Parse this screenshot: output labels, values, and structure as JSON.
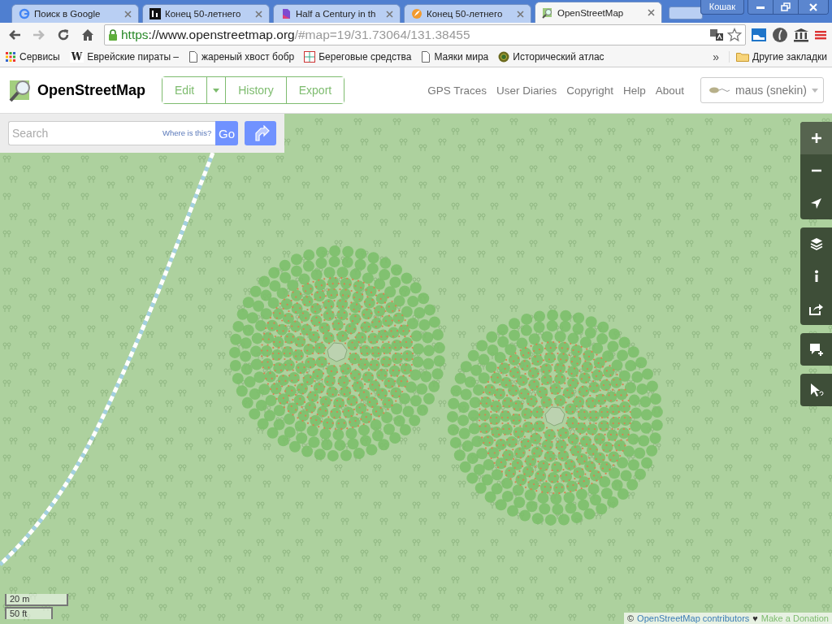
{
  "browser": {
    "tabs": [
      {
        "title": "Поиск в Google",
        "selected": false
      },
      {
        "title": "Конец 50-летнего",
        "selected": false
      },
      {
        "title": "Half a Century in th",
        "selected": false
      },
      {
        "title": "Конец 50-летнего",
        "selected": false
      },
      {
        "title": "OpenStreetMap",
        "selected": true
      }
    ],
    "profile": "Кошак",
    "address": {
      "scheme": "https",
      "host": "://www.openstreetmap.org",
      "path": "/#map=19/31.73064/131.38455"
    },
    "bookmarks": [
      {
        "label": "Сервисы"
      },
      {
        "label": "Еврейские пираты –",
        "letter": "W"
      },
      {
        "label": "жареный хвост бобр"
      },
      {
        "label": "Береговые средства"
      },
      {
        "label": "Маяки мира"
      },
      {
        "label": "Исторический атлас"
      }
    ],
    "more": "»",
    "other_bookmarks": "Другие закладки"
  },
  "site": {
    "brand": "OpenStreetMap",
    "actions": [
      {
        "label": "Edit",
        "dropdown": true
      },
      {
        "label": "History",
        "dropdown": false
      },
      {
        "label": "Export",
        "dropdown": false
      }
    ],
    "nav": [
      "GPS Traces",
      "User Diaries",
      "Copyright",
      "Help",
      "About"
    ],
    "user": "maus (snekin)",
    "search": {
      "placeholder": "Search",
      "where": "Where is this?",
      "go": "Go"
    }
  },
  "map": {
    "scale": [
      "20 m",
      "50 ft"
    ],
    "attribution": {
      "symbol": "©",
      "link": "OpenStreetMap contributors",
      "heart": "♥",
      "donate": "Make a Donation"
    }
  }
}
